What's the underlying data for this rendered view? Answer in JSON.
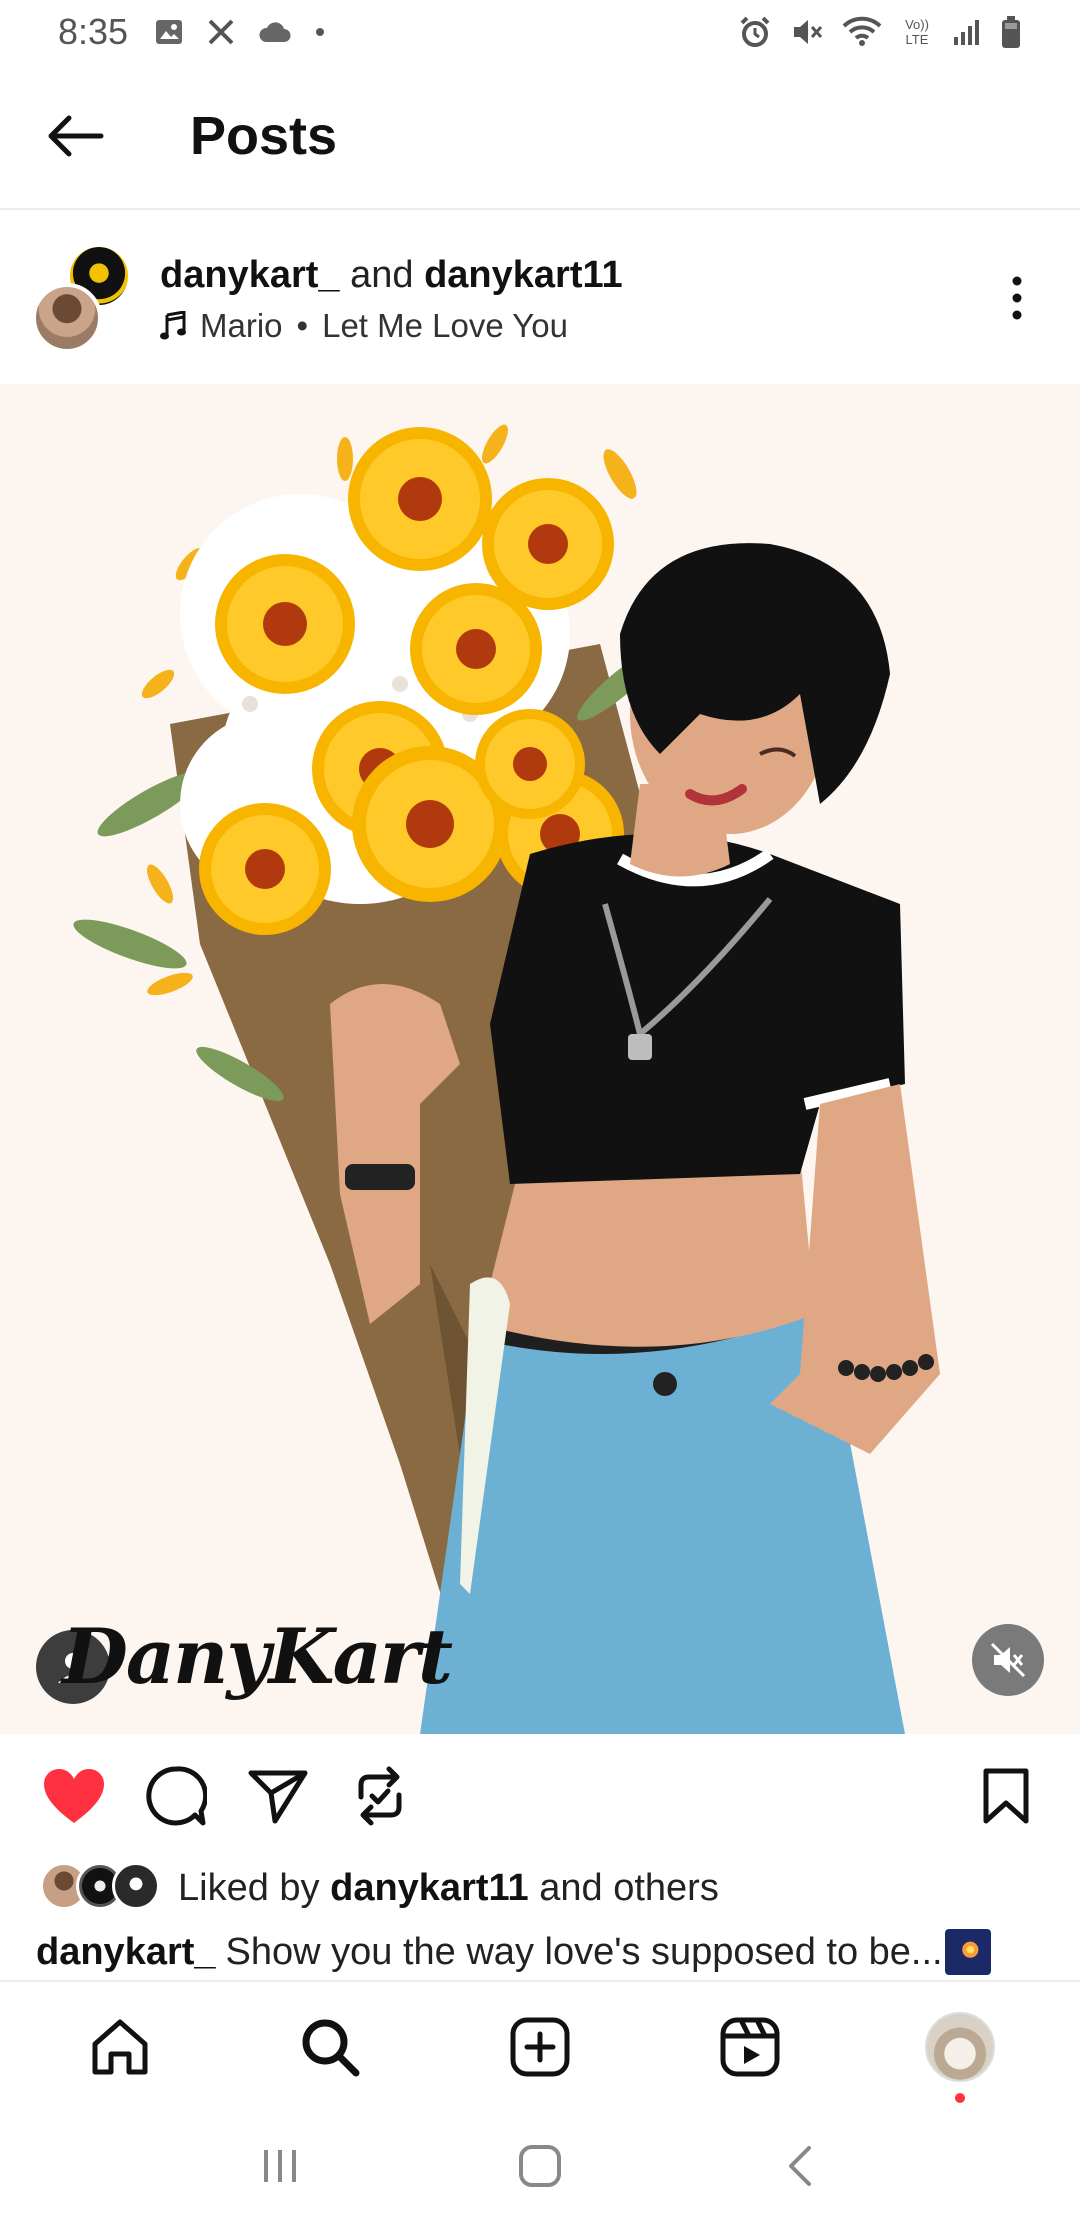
{
  "status_bar": {
    "time": "8:35",
    "left_icons": [
      "gallery-icon",
      "x-icon",
      "cloud-icon",
      "dot-icon"
    ],
    "right_icons": [
      "alarm-icon",
      "mute-icon",
      "wifi-icon",
      "volte-icon",
      "signal-icon",
      "battery-icon"
    ],
    "volte_label": "Vo)) LTE"
  },
  "header": {
    "title": "Posts",
    "back_icon": "arrow-left-icon"
  },
  "post": {
    "author_1": "danykart_",
    "connector": "and",
    "author_2": "danykart11",
    "music_artist": "Mario",
    "music_separator": "•",
    "music_song": "Let Me Love You",
    "watermark_text": "DanyKart",
    "liked_by_prefix": "Liked by",
    "liked_by_user": "danykart11",
    "liked_by_suffix": "and others",
    "caption_user": "danykart_",
    "caption_text": "Show you the way love's supposed to be..."
  },
  "colors": {
    "like_red": "#ff3040",
    "image_background": "#fcf5f0",
    "text_primary": "#111111"
  },
  "bottom_nav": {
    "items": [
      "home-icon",
      "search-icon",
      "create-icon",
      "reels-icon",
      "profile-avatar"
    ]
  },
  "system_nav": {
    "items": [
      "recents-icon",
      "home-button-icon",
      "back-icon"
    ]
  }
}
